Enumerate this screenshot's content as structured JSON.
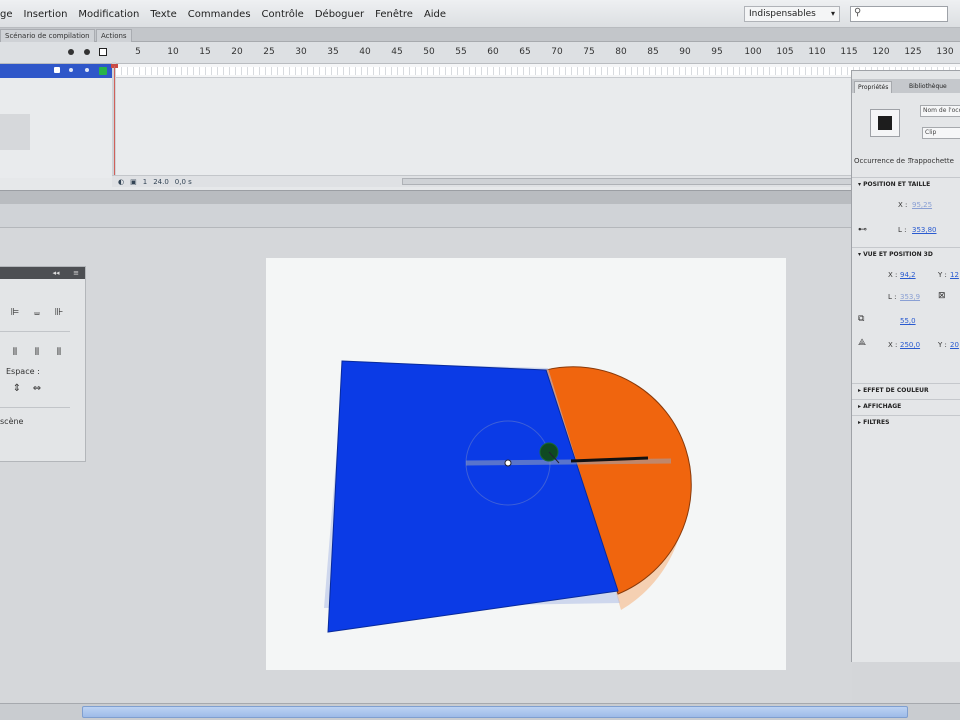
{
  "menu": {
    "items": [
      "ge",
      "Insertion",
      "Modification",
      "Texte",
      "Commandes",
      "Contrôle",
      "Déboguer",
      "Fenêtre",
      "Aide"
    ],
    "workspace_label": "Indispensables",
    "search_placeholder": ""
  },
  "panel_tabs": {
    "timeline": "Scénario de compilation",
    "actions": "Actions"
  },
  "timeline": {
    "frame_labels": [
      "5",
      "10",
      "15",
      "20",
      "25",
      "30",
      "35",
      "40",
      "45",
      "50",
      "55",
      "60",
      "65",
      "70",
      "75",
      "80",
      "85",
      "90",
      "95",
      "100",
      "105",
      "110",
      "115",
      "120",
      "125",
      "130"
    ],
    "status_fps": "24.0",
    "status_time": "0,0 s",
    "status_frame": "1"
  },
  "align_panel": {
    "spacing_label": "Espace :",
    "stage_label": "scène"
  },
  "properties": {
    "tab_properties": "Propriétés",
    "tab_library": "Bibliothèque",
    "instance_name_placeholder": "Nom de l'occurrence",
    "type_value": "Clip",
    "instance_of_label": "Occurrence de :",
    "instance_of_value": "Trappochette",
    "section_position": "POSITION ET TAILLE",
    "x_label": "X :",
    "x_value": "95,25",
    "w_label": "L :",
    "w_value": "353,80",
    "section_3d": "VUE ET POSITION 3D",
    "x3d_label": "X :",
    "x3d_value": "94,2",
    "y3d_label": "Y :",
    "y3d_value": "12",
    "l3d_label": "L :",
    "l3d_value": "353,9",
    "perspective_value": "55,0",
    "vx_label": "X :",
    "vx_value": "250,0",
    "vy_label": "Y :",
    "vy_value": "20",
    "section_color": "EFFET DE COULEUR",
    "section_display": "AFFICHAGE",
    "section_filters": "FILTRES"
  },
  "stage": {
    "background_color": "#f4f6f6",
    "rect_color": "#0b3be6",
    "half_disc_color": "#f0650e",
    "ghost_color": "#f4c9a6"
  }
}
